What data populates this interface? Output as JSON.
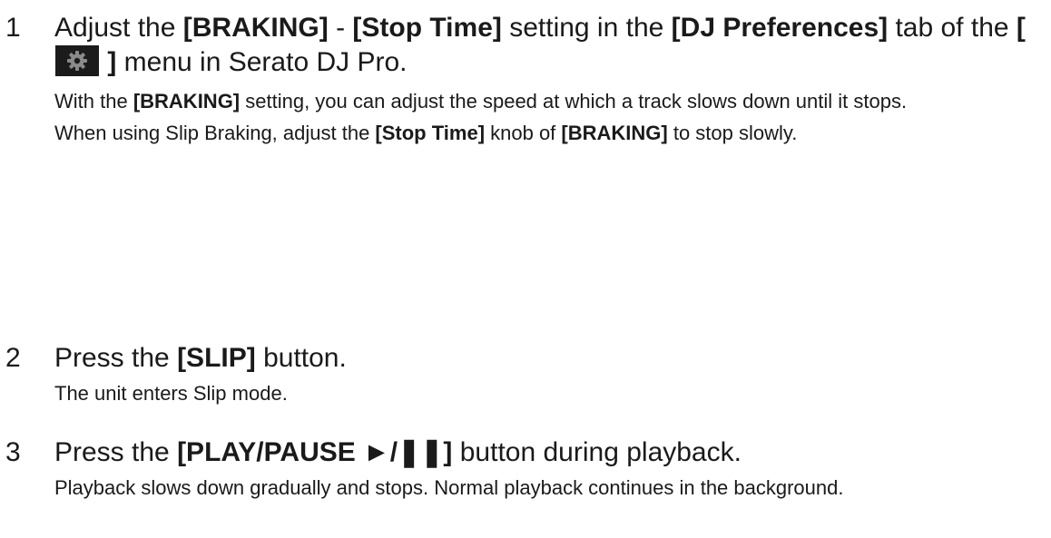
{
  "steps": [
    {
      "number": "1",
      "title": {
        "t1": "Adjust the ",
        "b1": "[BRAKING]",
        "t2": " - ",
        "b2": "[Stop Time]",
        "t3": " setting in the ",
        "b3": "[DJ Preferences]",
        "t4": " tab of the ",
        "b4_open": "[",
        "icon": "gear-icon",
        "b4_close": "]",
        "t5": " menu in Serato DJ Pro."
      },
      "desc1": {
        "t1": "With the ",
        "b1": "[BRAKING]",
        "t2": " setting, you can adjust the speed at which a track slows down until it stops."
      },
      "desc2": {
        "t1": "When using Slip Braking, adjust the ",
        "b1": "[Stop Time]",
        "t2": " knob of ",
        "b2": "[BRAKING]",
        "t3": " to stop slowly."
      }
    },
    {
      "number": "2",
      "title": {
        "t1": "Press the ",
        "b1": "[SLIP]",
        "t2": " button."
      },
      "desc": "The unit enters Slip mode."
    },
    {
      "number": "3",
      "title": {
        "t1": "Press the ",
        "b1": "[PLAY/PAUSE ►/❚❚]",
        "t2": " button during playback."
      },
      "desc": "Playback slows down gradually and stops. Normal playback continues in the background."
    }
  ],
  "colors": {
    "text": "#1a1a1a",
    "icon_box": "#1b1b1b",
    "icon_gear": "#8a8a8a"
  }
}
